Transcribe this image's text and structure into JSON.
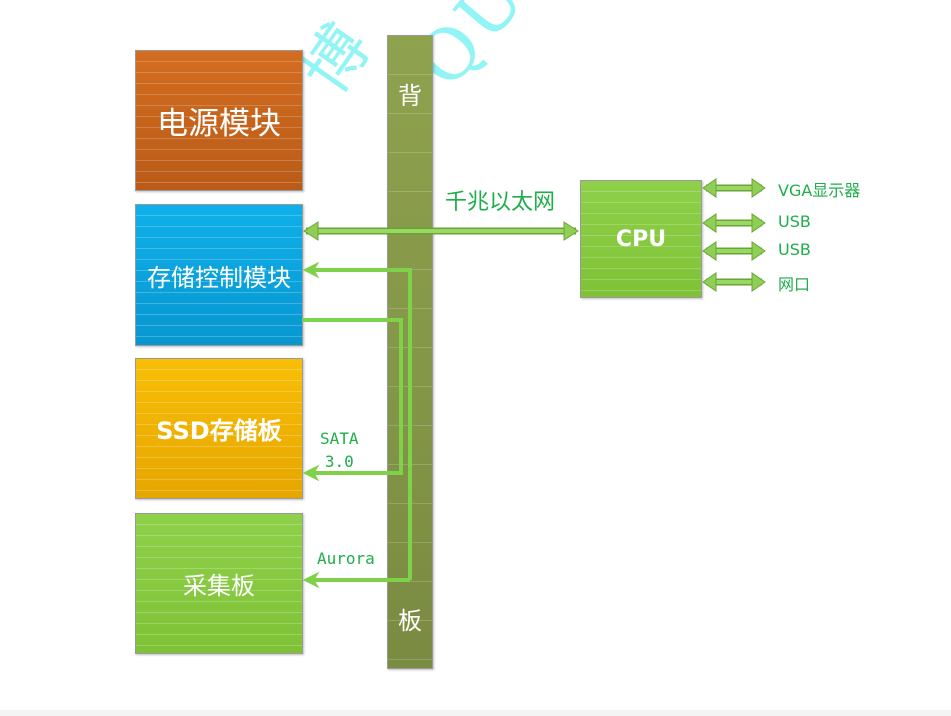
{
  "watermark": {
    "chars": [
      "博",
      "QUEEN"
    ]
  },
  "modules": {
    "power": {
      "label": "电源模块",
      "color": "#c9661f"
    },
    "storage_ctrl": {
      "label": "存储控制模块",
      "color": "#0aa6e2"
    },
    "ssd": {
      "label": "SSD存储板",
      "color": "#f2b000"
    },
    "acquisition": {
      "label": "采集板",
      "color": "#86c83e"
    }
  },
  "backplane": {
    "label_top": "背",
    "label_bottom": "板",
    "color": "#87994a"
  },
  "cpu": {
    "label": "CPU",
    "color": "#86c83e"
  },
  "links": {
    "ethernet": {
      "label": "千兆以太网"
    },
    "sata": {
      "label_line1": "SATA",
      "label_line2": "3.0"
    },
    "aurora": {
      "label": "Aurora"
    },
    "line_color": "#7fd14a"
  },
  "cpu_ports": [
    {
      "label": "VGA显示器"
    },
    {
      "label": "USB"
    },
    {
      "label": "USB"
    },
    {
      "label": "网口"
    }
  ]
}
